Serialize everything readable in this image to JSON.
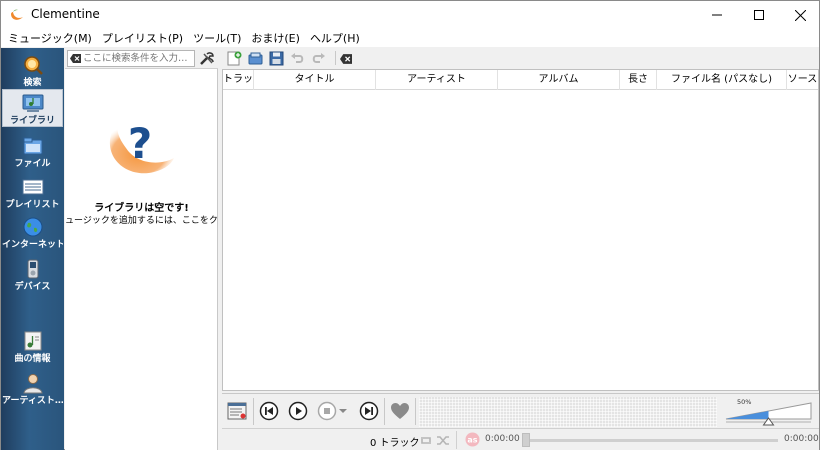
{
  "window": {
    "title": "Clementine",
    "controls": [
      "minimize",
      "maximize",
      "close"
    ]
  },
  "menubar": {
    "items": [
      "ミュージック(M)",
      "プレイリスト(P)",
      "ツール(T)",
      "おまけ(E)",
      "ヘルプ(H)"
    ]
  },
  "sidebar": {
    "items": [
      {
        "label": "検索",
        "icon": "search-icon",
        "active": false
      },
      {
        "label": "ライブラリ",
        "icon": "library-icon",
        "active": true
      },
      {
        "label": "ファイル",
        "icon": "files-icon",
        "active": false
      },
      {
        "label": "プレイリスト",
        "icon": "playlist-icon",
        "active": false
      },
      {
        "label": "インターネット",
        "icon": "internet-globe-icon",
        "active": false
      },
      {
        "label": "デバイス",
        "icon": "device-icon",
        "active": false
      },
      {
        "label": "曲の情報",
        "icon": "song-info-icon",
        "active": false
      },
      {
        "label": "アーティスト…",
        "icon": "artist-info-icon",
        "active": false
      }
    ]
  },
  "library": {
    "search_placeholder": "ここに検索条件を入力…",
    "empty_title": "ライブラリは空です!",
    "empty_subtitle": "ュージックを追加するには、ここをクリックします"
  },
  "playlist": {
    "columns": [
      "トラック",
      "タイトル",
      "アーティスト",
      "アルバム",
      "長さ",
      "ファイル名 (パスなし)",
      "ソース"
    ]
  },
  "player": {
    "volume_label": "50%",
    "volume_level_percent": 50
  },
  "status": {
    "track_count": "0 トラック",
    "elapsed": "0:00:00",
    "total": "0:00:00"
  },
  "colors": {
    "sidebar": "#2a557c",
    "accent_orange": "#f08a2c",
    "question_blue": "#1d4f8f"
  }
}
